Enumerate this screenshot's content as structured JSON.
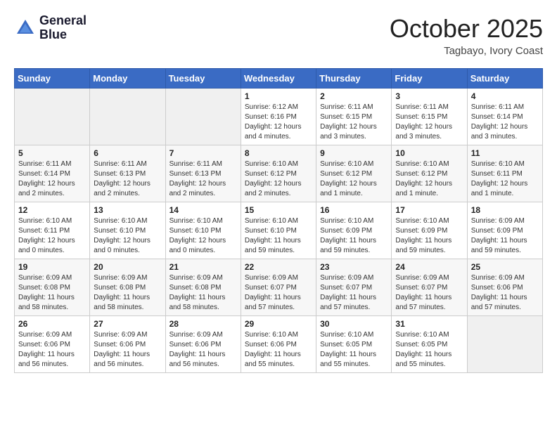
{
  "logo": {
    "line1": "General",
    "line2": "Blue"
  },
  "title": "October 2025",
  "location": "Tagbayo, Ivory Coast",
  "weekdays": [
    "Sunday",
    "Monday",
    "Tuesday",
    "Wednesday",
    "Thursday",
    "Friday",
    "Saturday"
  ],
  "weeks": [
    [
      {
        "day": "",
        "sunrise": "",
        "sunset": "",
        "daylight": ""
      },
      {
        "day": "",
        "sunrise": "",
        "sunset": "",
        "daylight": ""
      },
      {
        "day": "",
        "sunrise": "",
        "sunset": "",
        "daylight": ""
      },
      {
        "day": "1",
        "sunrise": "Sunrise: 6:12 AM",
        "sunset": "Sunset: 6:16 PM",
        "daylight": "Daylight: 12 hours and 4 minutes."
      },
      {
        "day": "2",
        "sunrise": "Sunrise: 6:11 AM",
        "sunset": "Sunset: 6:15 PM",
        "daylight": "Daylight: 12 hours and 3 minutes."
      },
      {
        "day": "3",
        "sunrise": "Sunrise: 6:11 AM",
        "sunset": "Sunset: 6:15 PM",
        "daylight": "Daylight: 12 hours and 3 minutes."
      },
      {
        "day": "4",
        "sunrise": "Sunrise: 6:11 AM",
        "sunset": "Sunset: 6:14 PM",
        "daylight": "Daylight: 12 hours and 3 minutes."
      }
    ],
    [
      {
        "day": "5",
        "sunrise": "Sunrise: 6:11 AM",
        "sunset": "Sunset: 6:14 PM",
        "daylight": "Daylight: 12 hours and 2 minutes."
      },
      {
        "day": "6",
        "sunrise": "Sunrise: 6:11 AM",
        "sunset": "Sunset: 6:13 PM",
        "daylight": "Daylight: 12 hours and 2 minutes."
      },
      {
        "day": "7",
        "sunrise": "Sunrise: 6:11 AM",
        "sunset": "Sunset: 6:13 PM",
        "daylight": "Daylight: 12 hours and 2 minutes."
      },
      {
        "day": "8",
        "sunrise": "Sunrise: 6:10 AM",
        "sunset": "Sunset: 6:12 PM",
        "daylight": "Daylight: 12 hours and 2 minutes."
      },
      {
        "day": "9",
        "sunrise": "Sunrise: 6:10 AM",
        "sunset": "Sunset: 6:12 PM",
        "daylight": "Daylight: 12 hours and 1 minute."
      },
      {
        "day": "10",
        "sunrise": "Sunrise: 6:10 AM",
        "sunset": "Sunset: 6:12 PM",
        "daylight": "Daylight: 12 hours and 1 minute."
      },
      {
        "day": "11",
        "sunrise": "Sunrise: 6:10 AM",
        "sunset": "Sunset: 6:11 PM",
        "daylight": "Daylight: 12 hours and 1 minute."
      }
    ],
    [
      {
        "day": "12",
        "sunrise": "Sunrise: 6:10 AM",
        "sunset": "Sunset: 6:11 PM",
        "daylight": "Daylight: 12 hours and 0 minutes."
      },
      {
        "day": "13",
        "sunrise": "Sunrise: 6:10 AM",
        "sunset": "Sunset: 6:10 PM",
        "daylight": "Daylight: 12 hours and 0 minutes."
      },
      {
        "day": "14",
        "sunrise": "Sunrise: 6:10 AM",
        "sunset": "Sunset: 6:10 PM",
        "daylight": "Daylight: 12 hours and 0 minutes."
      },
      {
        "day": "15",
        "sunrise": "Sunrise: 6:10 AM",
        "sunset": "Sunset: 6:10 PM",
        "daylight": "Daylight: 11 hours and 59 minutes."
      },
      {
        "day": "16",
        "sunrise": "Sunrise: 6:10 AM",
        "sunset": "Sunset: 6:09 PM",
        "daylight": "Daylight: 11 hours and 59 minutes."
      },
      {
        "day": "17",
        "sunrise": "Sunrise: 6:10 AM",
        "sunset": "Sunset: 6:09 PM",
        "daylight": "Daylight: 11 hours and 59 minutes."
      },
      {
        "day": "18",
        "sunrise": "Sunrise: 6:09 AM",
        "sunset": "Sunset: 6:09 PM",
        "daylight": "Daylight: 11 hours and 59 minutes."
      }
    ],
    [
      {
        "day": "19",
        "sunrise": "Sunrise: 6:09 AM",
        "sunset": "Sunset: 6:08 PM",
        "daylight": "Daylight: 11 hours and 58 minutes."
      },
      {
        "day": "20",
        "sunrise": "Sunrise: 6:09 AM",
        "sunset": "Sunset: 6:08 PM",
        "daylight": "Daylight: 11 hours and 58 minutes."
      },
      {
        "day": "21",
        "sunrise": "Sunrise: 6:09 AM",
        "sunset": "Sunset: 6:08 PM",
        "daylight": "Daylight: 11 hours and 58 minutes."
      },
      {
        "day": "22",
        "sunrise": "Sunrise: 6:09 AM",
        "sunset": "Sunset: 6:07 PM",
        "daylight": "Daylight: 11 hours and 57 minutes."
      },
      {
        "day": "23",
        "sunrise": "Sunrise: 6:09 AM",
        "sunset": "Sunset: 6:07 PM",
        "daylight": "Daylight: 11 hours and 57 minutes."
      },
      {
        "day": "24",
        "sunrise": "Sunrise: 6:09 AM",
        "sunset": "Sunset: 6:07 PM",
        "daylight": "Daylight: 11 hours and 57 minutes."
      },
      {
        "day": "25",
        "sunrise": "Sunrise: 6:09 AM",
        "sunset": "Sunset: 6:06 PM",
        "daylight": "Daylight: 11 hours and 57 minutes."
      }
    ],
    [
      {
        "day": "26",
        "sunrise": "Sunrise: 6:09 AM",
        "sunset": "Sunset: 6:06 PM",
        "daylight": "Daylight: 11 hours and 56 minutes."
      },
      {
        "day": "27",
        "sunrise": "Sunrise: 6:09 AM",
        "sunset": "Sunset: 6:06 PM",
        "daylight": "Daylight: 11 hours and 56 minutes."
      },
      {
        "day": "28",
        "sunrise": "Sunrise: 6:09 AM",
        "sunset": "Sunset: 6:06 PM",
        "daylight": "Daylight: 11 hours and 56 minutes."
      },
      {
        "day": "29",
        "sunrise": "Sunrise: 6:10 AM",
        "sunset": "Sunset: 6:06 PM",
        "daylight": "Daylight: 11 hours and 55 minutes."
      },
      {
        "day": "30",
        "sunrise": "Sunrise: 6:10 AM",
        "sunset": "Sunset: 6:05 PM",
        "daylight": "Daylight: 11 hours and 55 minutes."
      },
      {
        "day": "31",
        "sunrise": "Sunrise: 6:10 AM",
        "sunset": "Sunset: 6:05 PM",
        "daylight": "Daylight: 11 hours and 55 minutes."
      },
      {
        "day": "",
        "sunrise": "",
        "sunset": "",
        "daylight": ""
      }
    ]
  ]
}
